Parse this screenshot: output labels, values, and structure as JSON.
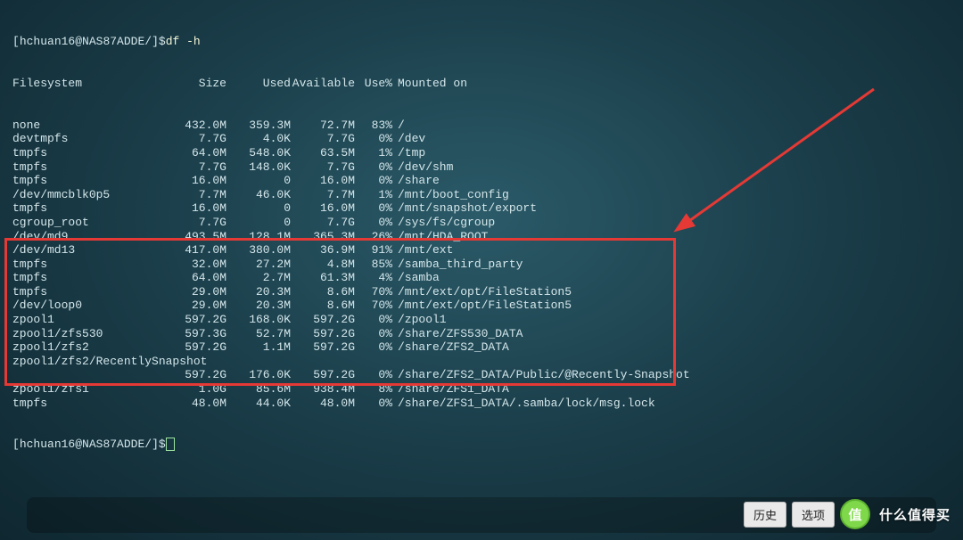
{
  "prompt": {
    "user": "hchuan16",
    "host": "NAS87ADDE",
    "path": "/",
    "symbol": "$"
  },
  "command": "df -h",
  "header": {
    "fs": "Filesystem",
    "sz": "Size",
    "us": "Used",
    "av": "Available",
    "up": "Use%",
    "mn": "Mounted on"
  },
  "rows": [
    {
      "fs": "none",
      "sz": "432.0M",
      "us": "359.3M",
      "av": "72.7M",
      "up": "83%",
      "mn": "/"
    },
    {
      "fs": "devtmpfs",
      "sz": "7.7G",
      "us": "4.0K",
      "av": "7.7G",
      "up": "0%",
      "mn": "/dev"
    },
    {
      "fs": "tmpfs",
      "sz": "64.0M",
      "us": "548.0K",
      "av": "63.5M",
      "up": "1%",
      "mn": "/tmp"
    },
    {
      "fs": "tmpfs",
      "sz": "7.7G",
      "us": "148.0K",
      "av": "7.7G",
      "up": "0%",
      "mn": "/dev/shm"
    },
    {
      "fs": "tmpfs",
      "sz": "16.0M",
      "us": "0",
      "av": "16.0M",
      "up": "0%",
      "mn": "/share"
    },
    {
      "fs": "/dev/mmcblk0p5",
      "sz": "7.7M",
      "us": "46.0K",
      "av": "7.7M",
      "up": "1%",
      "mn": "/mnt/boot_config"
    },
    {
      "fs": "tmpfs",
      "sz": "16.0M",
      "us": "0",
      "av": "16.0M",
      "up": "0%",
      "mn": "/mnt/snapshot/export"
    },
    {
      "fs": "cgroup_root",
      "sz": "7.7G",
      "us": "0",
      "av": "7.7G",
      "up": "0%",
      "mn": "/sys/fs/cgroup"
    },
    {
      "fs": "/dev/md9",
      "sz": "493.5M",
      "us": "128.1M",
      "av": "365.3M",
      "up": "26%",
      "mn": "/mnt/HDA_ROOT"
    },
    {
      "fs": "/dev/md13",
      "sz": "417.0M",
      "us": "380.0M",
      "av": "36.9M",
      "up": "91%",
      "mn": "/mnt/ext"
    },
    {
      "fs": "tmpfs",
      "sz": "32.0M",
      "us": "27.2M",
      "av": "4.8M",
      "up": "85%",
      "mn": "/samba_third_party"
    },
    {
      "fs": "tmpfs",
      "sz": "64.0M",
      "us": "2.7M",
      "av": "61.3M",
      "up": "4%",
      "mn": "/samba"
    },
    {
      "fs": "tmpfs",
      "sz": "29.0M",
      "us": "20.3M",
      "av": "8.6M",
      "up": "70%",
      "mn": "/mnt/ext/opt/FileStation5"
    },
    {
      "fs": "/dev/loop0",
      "sz": "29.0M",
      "us": "20.3M",
      "av": "8.6M",
      "up": "70%",
      "mn": "/mnt/ext/opt/FileStation5"
    },
    {
      "fs": "zpool1",
      "sz": "597.2G",
      "us": "168.0K",
      "av": "597.2G",
      "up": "0%",
      "mn": "/zpool1"
    },
    {
      "fs": "zpool1/zfs530",
      "sz": "597.3G",
      "us": "52.7M",
      "av": "597.2G",
      "up": "0%",
      "mn": "/share/ZFS530_DATA"
    },
    {
      "fs": "zpool1/zfs2",
      "sz": "597.2G",
      "us": "1.1M",
      "av": "597.2G",
      "up": "0%",
      "mn": "/share/ZFS2_DATA"
    },
    {
      "fs": "zpool1/zfs2/RecentlySnapshot"
    },
    {
      "fs": "",
      "sz": "597.2G",
      "us": "176.0K",
      "av": "597.2G",
      "up": "0%",
      "mn": "/share/ZFS2_DATA/Public/@Recently-Snapshot"
    },
    {
      "fs": "zpool1/zfs1",
      "sz": "1.0G",
      "us": "85.6M",
      "av": "938.4M",
      "up": "8%",
      "mn": "/share/ZFS1_DATA"
    },
    {
      "fs": "tmpfs",
      "sz": "48.0M",
      "us": "44.0K",
      "av": "48.0M",
      "up": "0%",
      "mn": "/share/ZFS1_DATA/.samba/lock/msg.lock"
    }
  ],
  "buttons": {
    "history": "历史",
    "options": "选项"
  },
  "watermark": {
    "badge": "值",
    "text": "什么值得买"
  }
}
